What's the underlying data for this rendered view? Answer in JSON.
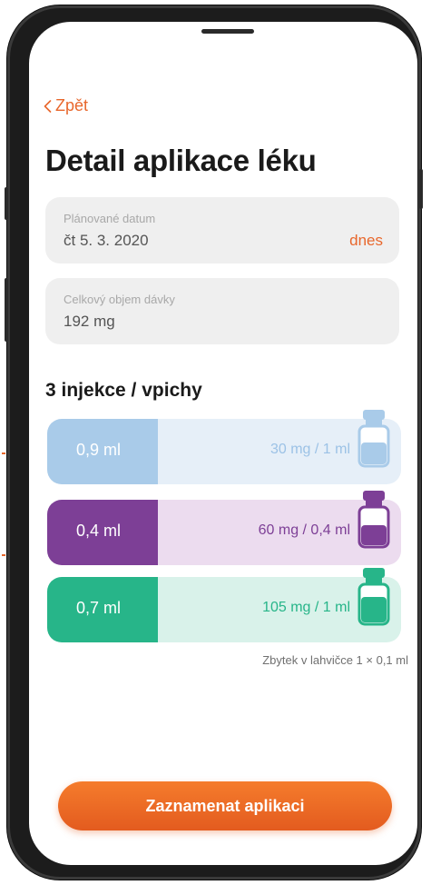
{
  "nav": {
    "back_label": "Zpět"
  },
  "page": {
    "title": "Detail aplikace léku"
  },
  "planned_date": {
    "label": "Plánované datum",
    "value": "čt 5. 3. 2020",
    "relative": "dnes"
  },
  "total_dose": {
    "label": "Celkový objem dávky",
    "value": "192 mg"
  },
  "injections": {
    "heading": "3 injekce / vpichy",
    "items": [
      {
        "volume": "0,9 ml",
        "concentration": "30 mg / 1 ml",
        "accent": "#a9cbe9",
        "background": "#e6eff8",
        "text_color": "#9cc2e6",
        "vial_icon": "vial-icon"
      },
      {
        "volume": "0,4 ml",
        "concentration": "60 mg / 0,4 ml",
        "accent": "#7d3f96",
        "background": "#ecdcef",
        "text_color": "#7d3f96",
        "vial_icon": "vial-icon"
      },
      {
        "volume": "0,7 ml",
        "concentration": "105 mg / 1 ml",
        "accent": "#27b589",
        "background": "#d9f2ea",
        "text_color": "#27b589",
        "vial_icon": "vial-icon"
      }
    ],
    "remainder": "Zbytek v lahvičce 1 × 0,1 ml"
  },
  "actions": {
    "record_label": "Zaznamenat aplikaci"
  },
  "colors": {
    "accent": "#e8672c",
    "card": "#efefef"
  }
}
